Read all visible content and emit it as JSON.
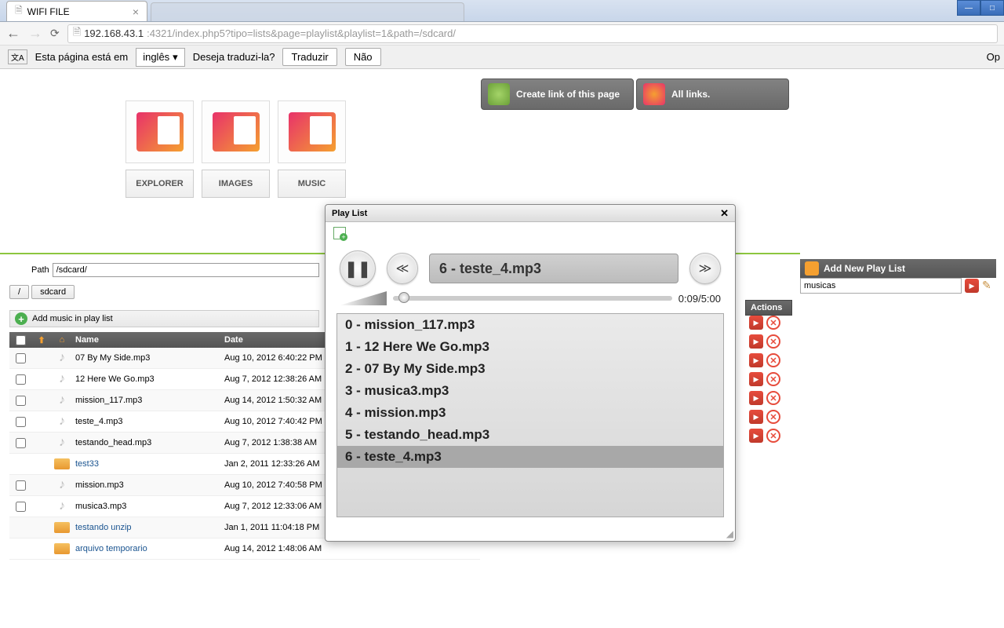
{
  "browser": {
    "tab_title": "WIFI FILE",
    "url_host": "192.168.43.1",
    "url_rest": ":4321/index.php5?tipo=lists&page=playlist&playlist=1&path=/sdcard/"
  },
  "translate": {
    "msg1": "Esta página está em",
    "lang": "inglês",
    "msg2": "Deseja traduzi-la?",
    "btn_translate": "Traduzir",
    "btn_no": "Não",
    "opt": "Op"
  },
  "linkbar": {
    "create": "Create link of this page",
    "all": "All links."
  },
  "nav": {
    "explorer": "EXPLORER",
    "images": "IMAGES",
    "music": "MUSIC"
  },
  "path": {
    "label": "Path",
    "value": "/sdcard/",
    "crumb_root": "/",
    "crumb_sd": "sdcard"
  },
  "addmusic": "Add music in play list",
  "table": {
    "hdr_name": "Name",
    "hdr_date": "Date",
    "rows": [
      {
        "chk": true,
        "type": "audio",
        "name": "07 By My Side.mp3",
        "date": "Aug 10, 2012 6:40:22 PM"
      },
      {
        "chk": true,
        "type": "audio",
        "name": "12 Here We Go.mp3",
        "date": "Aug 7, 2012 12:38:26 AM"
      },
      {
        "chk": true,
        "type": "audio",
        "name": "mission_117.mp3",
        "date": "Aug 14, 2012 1:50:32 AM"
      },
      {
        "chk": true,
        "type": "audio",
        "name": "teste_4.mp3",
        "date": "Aug 10, 2012 7:40:42 PM"
      },
      {
        "chk": true,
        "type": "audio",
        "name": "testando_head.mp3",
        "date": "Aug 7, 2012 1:38:38 AM"
      },
      {
        "chk": false,
        "type": "folder",
        "name": "test33",
        "date": "Jan 2, 2011 12:33:26 AM"
      },
      {
        "chk": true,
        "type": "audio",
        "name": "mission.mp3",
        "date": "Aug 10, 2012 7:40:58 PM"
      },
      {
        "chk": true,
        "type": "audio",
        "name": "musica3.mp3",
        "date": "Aug 7, 2012 12:33:06 AM"
      },
      {
        "chk": false,
        "type": "folder",
        "name": "testando unzip",
        "date": "Jan 1, 2011 11:04:18 PM"
      },
      {
        "chk": false,
        "type": "folder",
        "name": "arquivo temporario",
        "date": "Aug 14, 2012 1:48:06 AM"
      }
    ]
  },
  "actions_hdr": "Actions",
  "dialog": {
    "title": "Play List",
    "now_playing": "6 - teste_4.mp3",
    "time": "0:09/5:00",
    "tracks": [
      "0 - mission_117.mp3",
      "1 - 12 Here We Go.mp3",
      "2 - 07 By My Side.mp3",
      "3 - musica3.mp3",
      "4 - mission.mp3",
      "5 - testando_head.mp3",
      "6 - teste_4.mp3"
    ],
    "selected_index": 6
  },
  "addpl": {
    "title": "Add New Play List",
    "value": "musicas"
  }
}
